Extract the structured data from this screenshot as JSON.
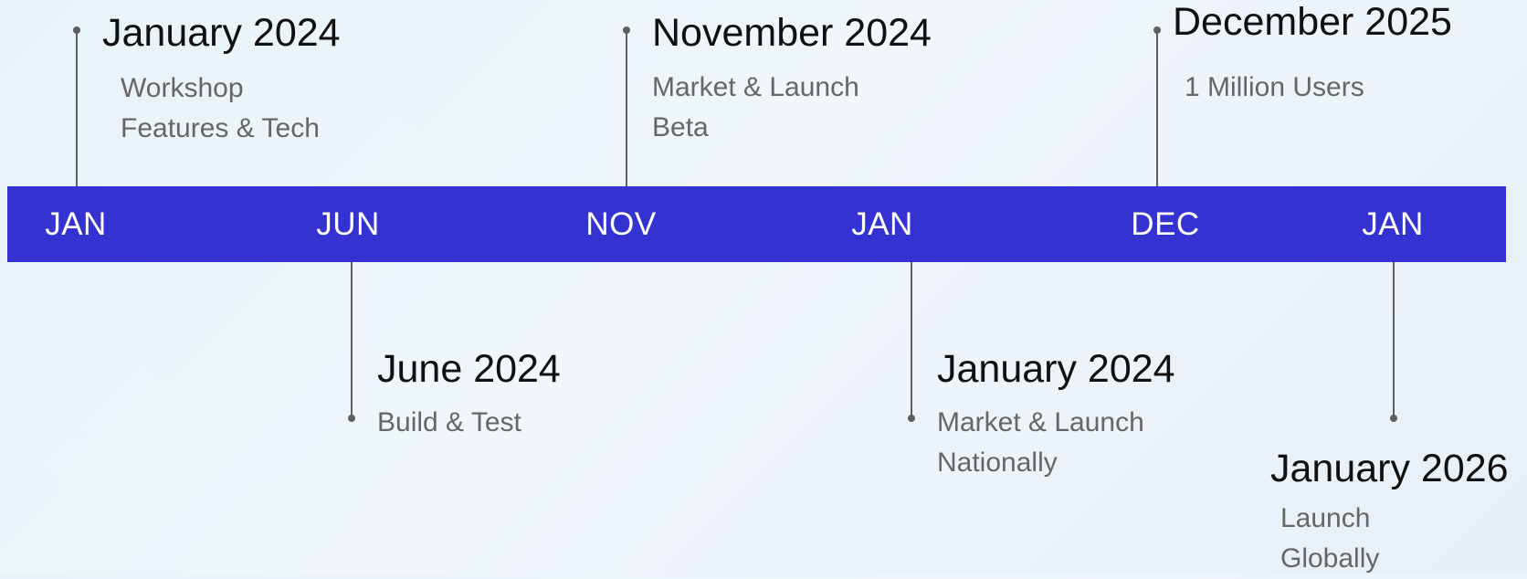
{
  "timeline": {
    "bar_color": "#3532d2",
    "months": [
      "JAN",
      "JUN",
      "NOV",
      "JAN",
      "DEC",
      "JAN"
    ]
  },
  "events": [
    {
      "title": "January 2024",
      "lines": [
        "Workshop",
        "Features & Tech"
      ]
    },
    {
      "title": "June 2024",
      "lines": [
        "Build & Test"
      ]
    },
    {
      "title": "November 2024",
      "lines": [
        "Market & Launch",
        "Beta"
      ]
    },
    {
      "title": "January 2024",
      "lines": [
        "Market & Launch",
        "Nationally"
      ]
    },
    {
      "title": "December 2025",
      "lines": [
        "1 Million Users"
      ]
    },
    {
      "title": "January 2026",
      "lines": [
        "Launch",
        "Globally"
      ]
    }
  ]
}
